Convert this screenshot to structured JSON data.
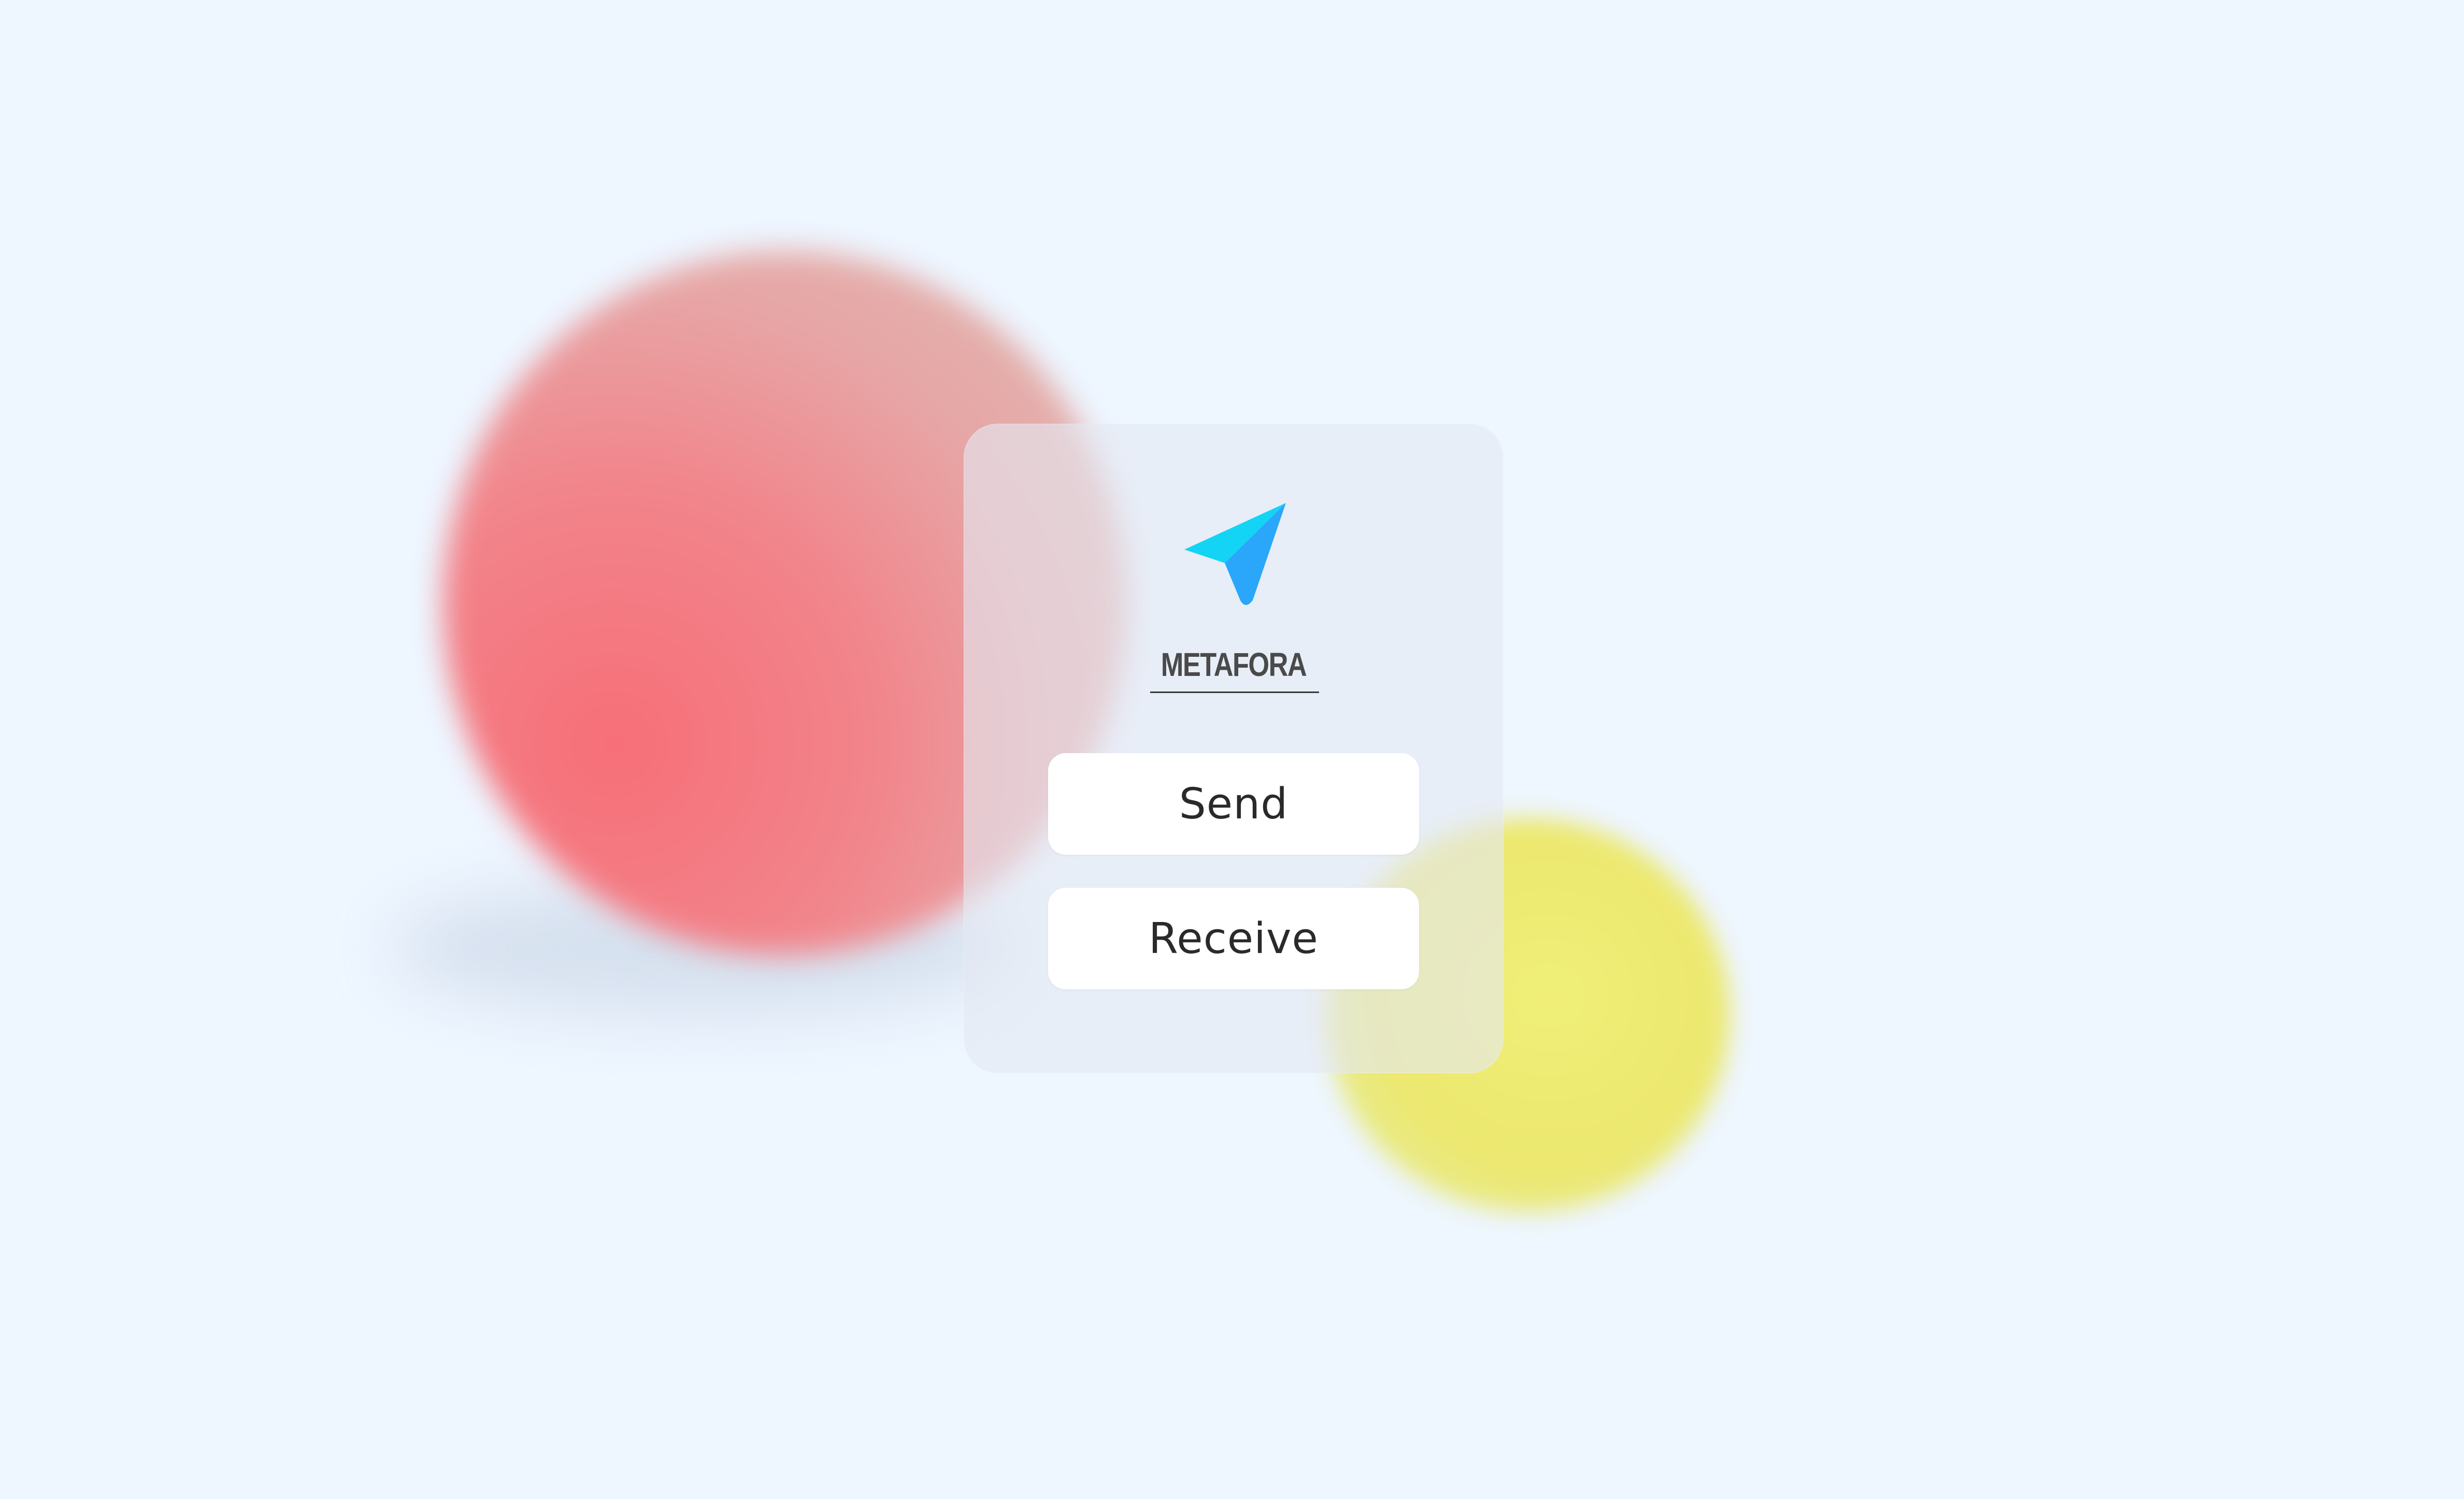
{
  "app": {
    "brand_name": "METAFORA",
    "logo_icon": "navigation-arrow-icon"
  },
  "actions": {
    "send_label": "Send",
    "receive_label": "Receive"
  },
  "colors": {
    "background": "#eef6ff",
    "logo_light": "#13d4f5",
    "logo_dark": "#2aa6fb",
    "blob_red": "#f76f78",
    "blob_yellow": "#f0ef77",
    "button_bg": "#ffffff"
  }
}
